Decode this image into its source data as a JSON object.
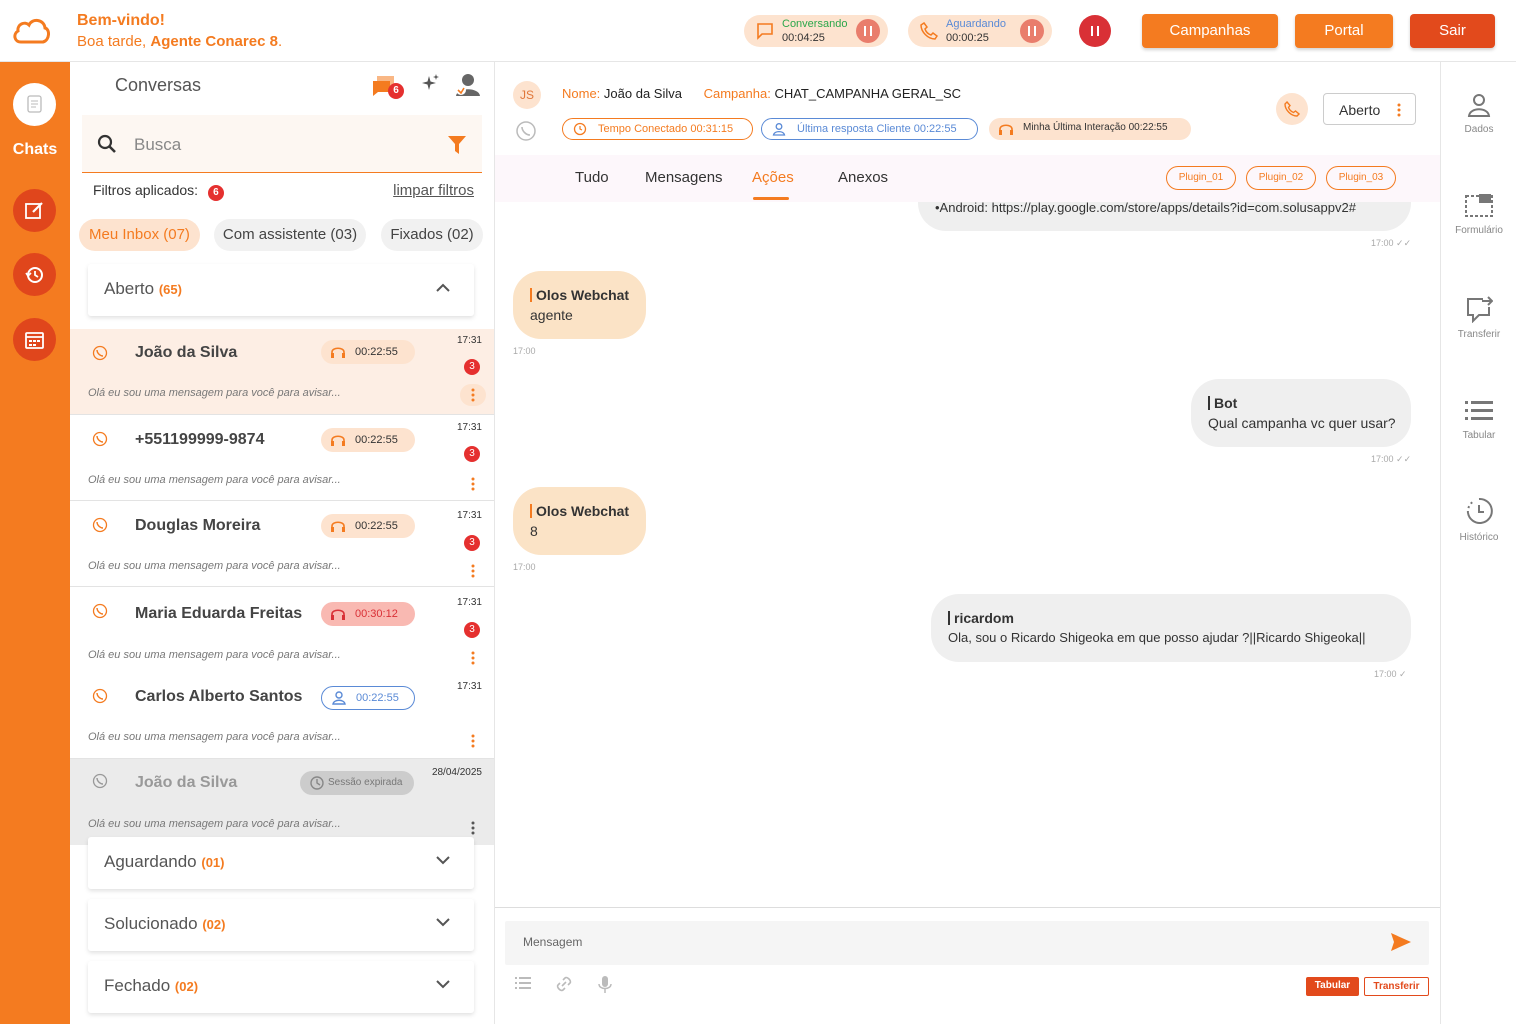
{
  "header": {
    "welcome": "Bem-vindo!",
    "greeting_prefix": "Boa tarde, ",
    "agent": "Agente Conarec 8",
    "greeting_suffix": ".",
    "status_conversando": {
      "label": "Conversando",
      "time": "00:04:25"
    },
    "status_aguardando": {
      "label": "Aguardando",
      "time": "00:00:25"
    },
    "buttons": {
      "campanhas": "Campanhas",
      "portal": "Portal",
      "sair": "Sair"
    }
  },
  "rail": {
    "chats_label": "Chats"
  },
  "conversations": {
    "title": "Conversas",
    "notif_count": "6",
    "search_placeholder": "Busca",
    "filters_label": "Filtros aplicados:",
    "filters_count": "6",
    "clear_filters": "limpar filtros",
    "chips": [
      "Meu Inbox (07)",
      "Com assistente (03)",
      "Fixados (02)"
    ],
    "sections": {
      "aberto": {
        "label": "Aberto",
        "count": "(65)"
      },
      "aguardando": {
        "label": "Aguardando",
        "count": "(01)"
      },
      "solucionado": {
        "label": "Solucionado",
        "count": "(02)"
      },
      "fechado": {
        "label": "Fechado",
        "count": "(02)"
      }
    },
    "items": [
      {
        "name": "João da Silva",
        "timer": "00:22:55",
        "time": "17:31",
        "unread": "3",
        "preview": "Olá eu sou uma mensagem para você para avisar..."
      },
      {
        "name": "+551199999-9874",
        "timer": "00:22:55",
        "time": "17:31",
        "unread": "3",
        "preview": "Olá eu sou uma mensagem para você para avisar..."
      },
      {
        "name": "Douglas Moreira",
        "timer": "00:22:55",
        "time": "17:31",
        "unread": "3",
        "preview": "Olá eu sou uma mensagem para você para avisar..."
      },
      {
        "name": "Maria Eduarda Freitas",
        "timer": "00:30:12",
        "time": "17:31",
        "unread": "3",
        "preview": "Olá eu sou uma mensagem para você para avisar..."
      },
      {
        "name": "Carlos Alberto Santos",
        "timer": "00:22:55",
        "time": "17:31",
        "unread": "",
        "preview": "Olá eu sou uma mensagem para você para avisar..."
      },
      {
        "name": "João da Silva",
        "timer": "Sessão expirada",
        "time": "28/04/2025",
        "unread": "",
        "preview": "Olá eu sou uma mensagem para você para avisar..."
      }
    ]
  },
  "chat": {
    "initials": "JS",
    "name_label": "Nome:",
    "name": "João da Silva",
    "campaign_label": "Campanha:",
    "campaign": "CHAT_CAMPANHA GERAL_SC",
    "connected": "Tempo Conectado 00:31:15",
    "last_client": "Última resposta Cliente 00:22:55",
    "my_last": "Minha Última Interação 00:22:55",
    "status": "Aberto",
    "tabs": [
      "Tudo",
      "Mensagens",
      "Ações",
      "Anexos"
    ],
    "plugins": [
      "Plugin_01",
      "Plugin_02",
      "Plugin_03"
    ],
    "messages": [
      {
        "who": "",
        "text": "•Android: https://play.google.com/store/apps/details?id=com.solusappv2#",
        "time": "17:00 ✓✓"
      },
      {
        "who": "Olos Webchat",
        "text": "agente",
        "time": "17:00"
      },
      {
        "who": "Bot",
        "text": "Qual campanha vc quer usar?",
        "time": "17:00 ✓✓"
      },
      {
        "who": "Olos Webchat",
        "text": "8",
        "time": "17:00"
      },
      {
        "who": "ricardom",
        "text": "Ola, sou o Ricardo Shigeoka em que posso ajudar ?||Ricardo Shigeoka||",
        "time": "17:00 ✓"
      }
    ],
    "composer_placeholder": "Mensagem",
    "tabular": "Tabular",
    "transferir": "Transferir"
  },
  "right_rail": [
    "Dados",
    "Formulário",
    "Transferir",
    "Tabular",
    "Histórico"
  ],
  "colors": {
    "accent": "#f47b20",
    "danger": "#e5302f",
    "blue": "#5a8ad6",
    "green": "#2ca74b"
  }
}
